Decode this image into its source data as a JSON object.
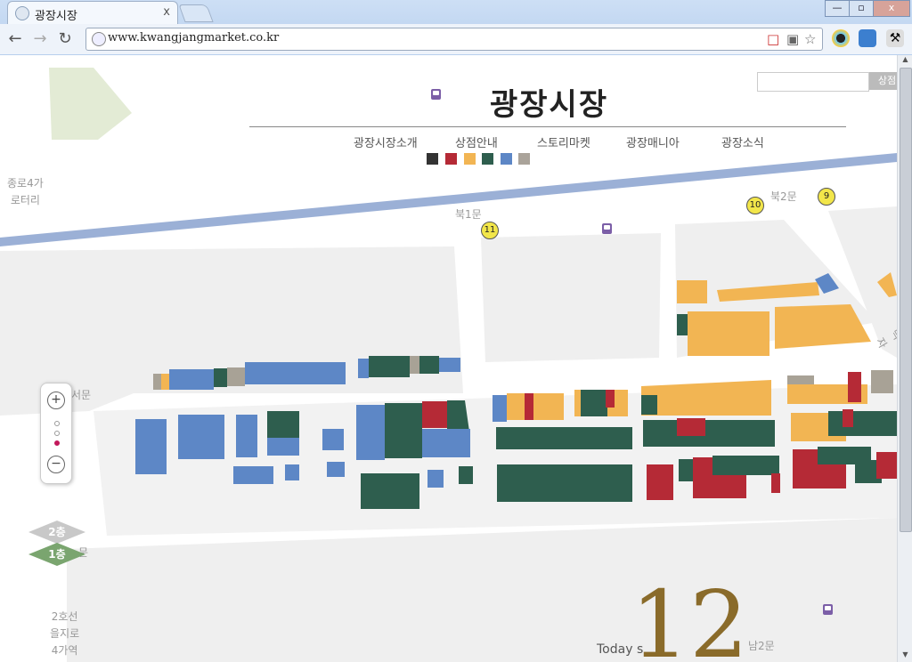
{
  "browser": {
    "tab_title": "광장시장",
    "tab_close": "x",
    "url": "www.kwangjangmarket.co.kr",
    "win_min": "—",
    "win_max": "▫",
    "win_close": "x"
  },
  "site": {
    "logo": "광장시장",
    "search_button": "상점",
    "menu": [
      "광장시장소개",
      "상점안내",
      "스토리마켓",
      "광장매니아",
      "광장소식"
    ],
    "swatches": [
      "#333333",
      "#b52a36",
      "#f2b553",
      "#2e5e4e",
      "#5d87c6",
      "#aaa39a"
    ]
  },
  "map": {
    "labels": {
      "rotary": "종로4가\n로터리",
      "north1": "북1문",
      "north2": "북2문",
      "west": "서문",
      "west_lower": "문",
      "station": "2호선\n을지로\n4가역",
      "south2": "남2문",
      "east": "먹자"
    },
    "markers": {
      "m9": "9",
      "m10": "10",
      "m11": "11"
    },
    "floors": {
      "f2": "2층",
      "f1": "1층"
    },
    "zoom_in": "+",
    "zoom_out": "−"
  },
  "today": {
    "label": "Today s",
    "number": "12"
  }
}
